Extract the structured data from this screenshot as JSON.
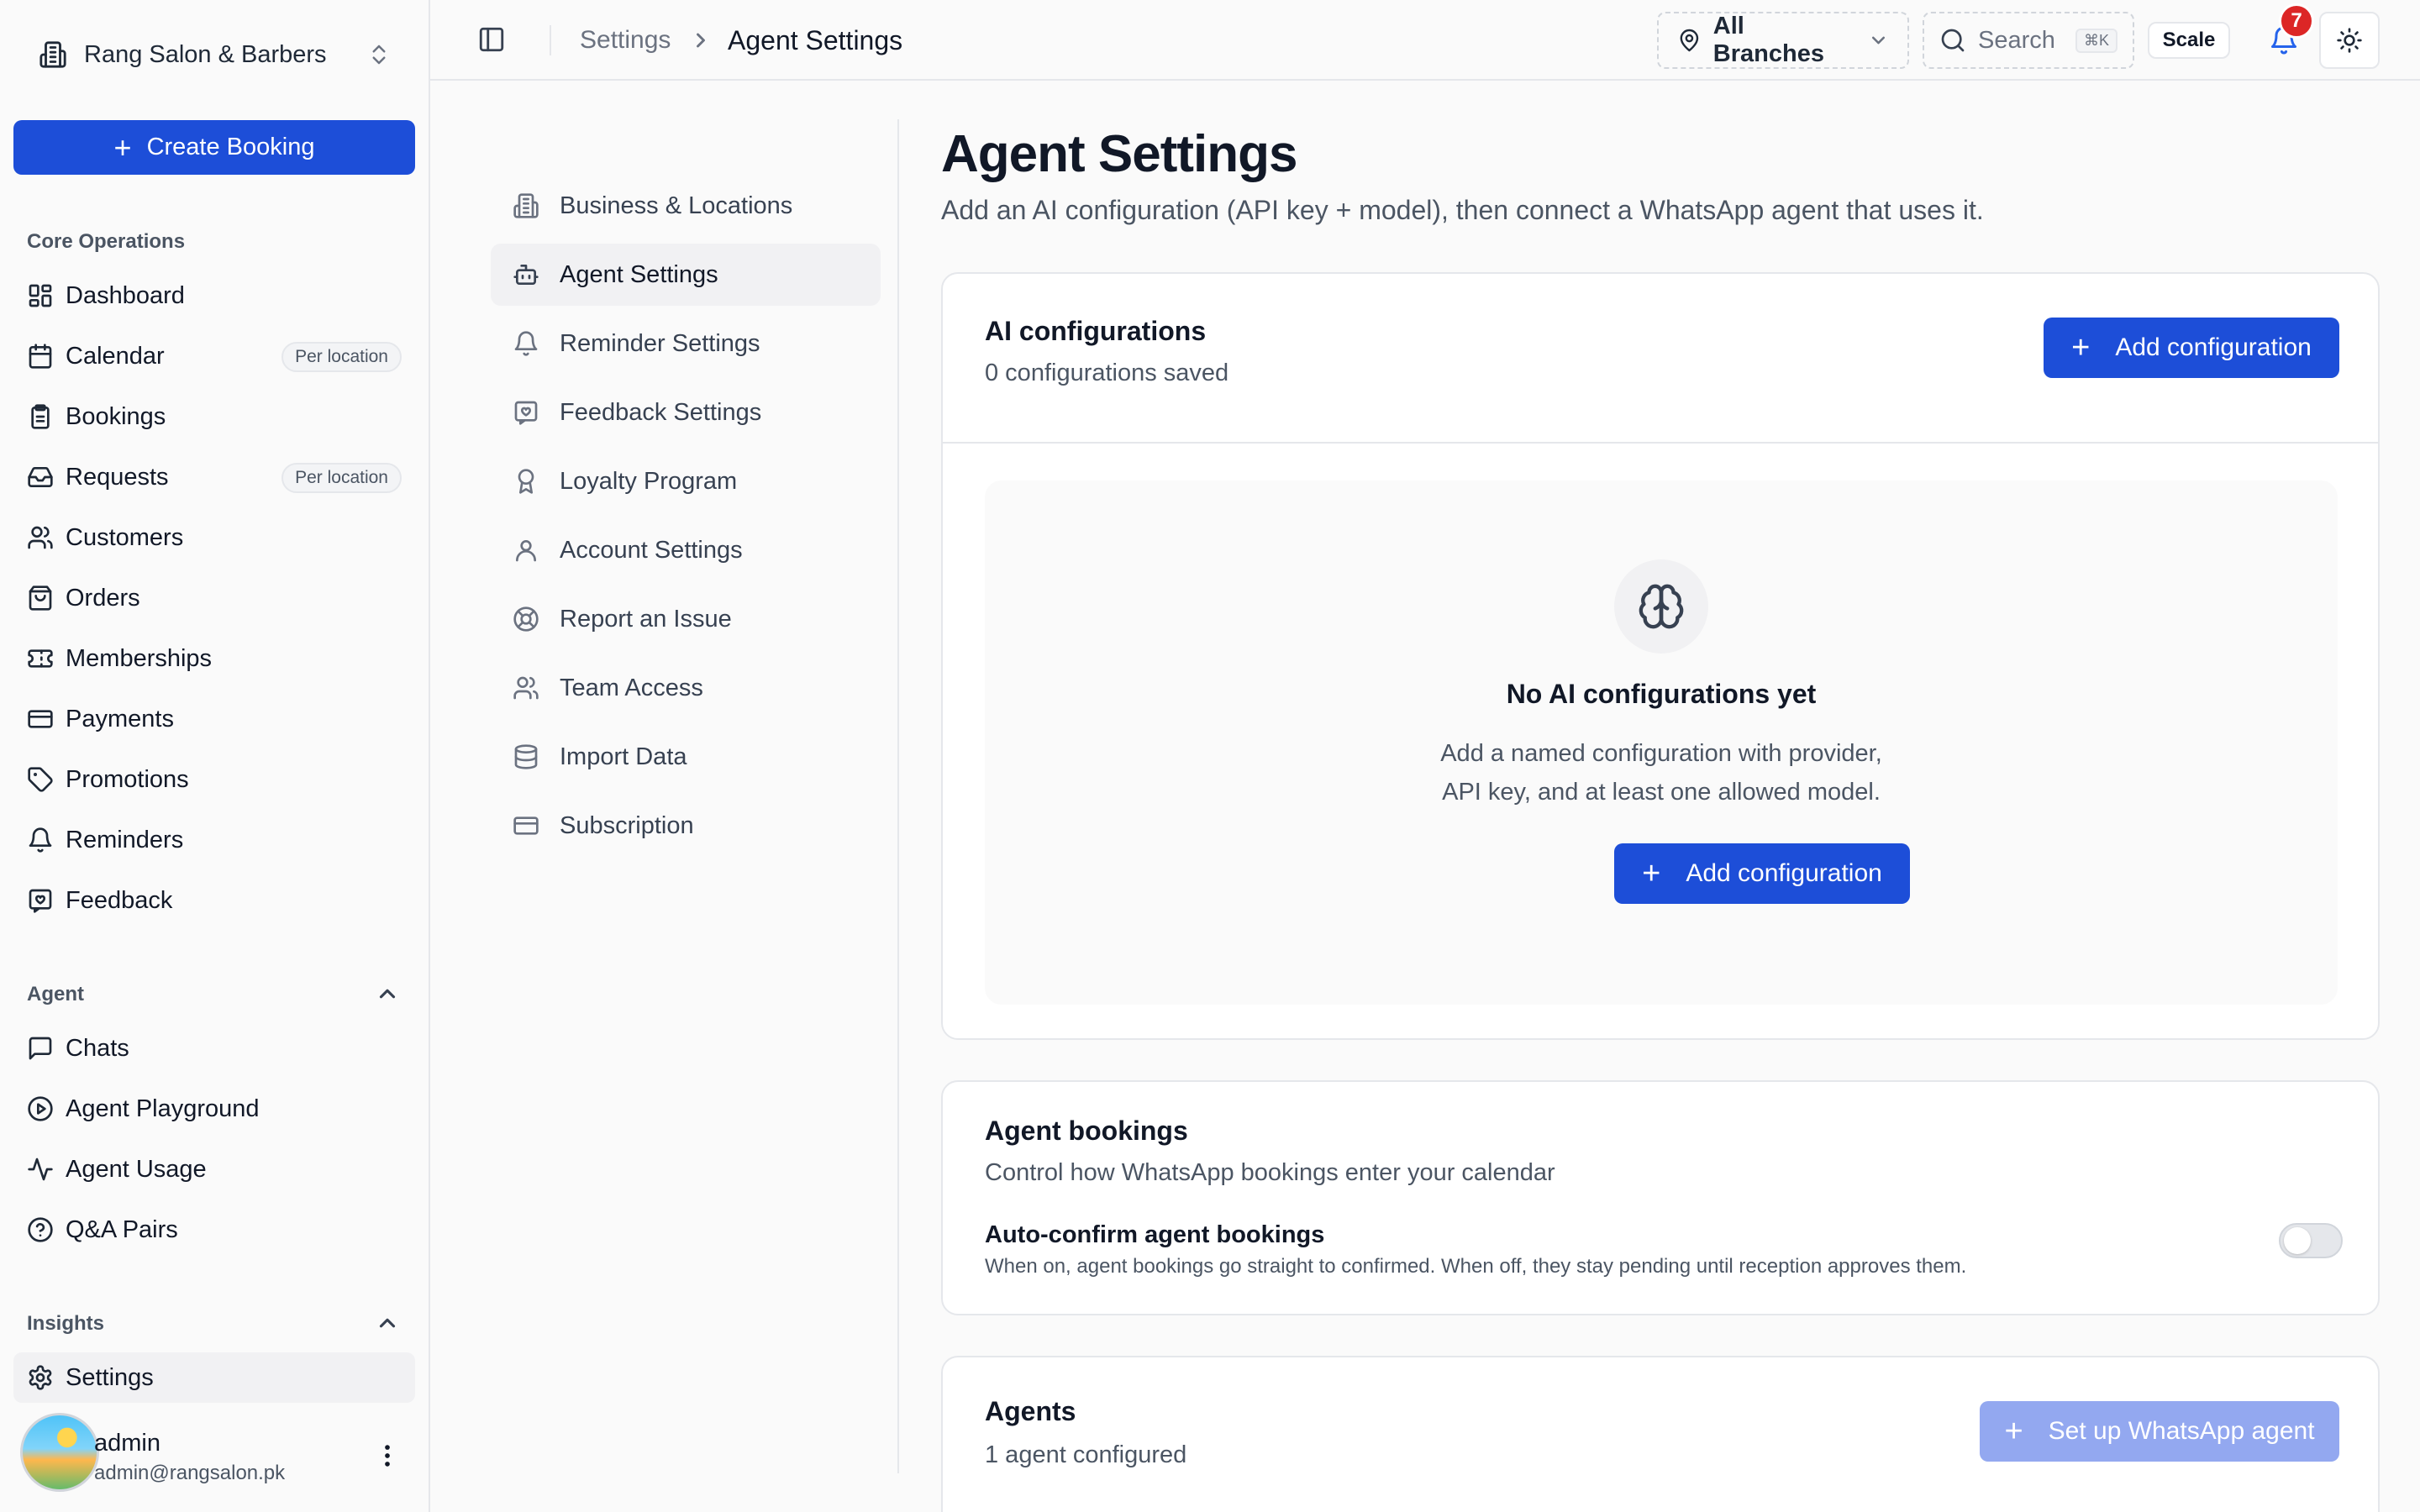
{
  "org": {
    "name": "Rang Salon & Barbers"
  },
  "sidebar": {
    "create_label": "Create Booking",
    "core_label": "Core Operations",
    "core_items": [
      {
        "label": "Dashboard",
        "icon": "dashboard-icon"
      },
      {
        "label": "Calendar",
        "icon": "calendar-icon",
        "badge": "Per location"
      },
      {
        "label": "Bookings",
        "icon": "clipboard-icon"
      },
      {
        "label": "Requests",
        "icon": "inbox-icon",
        "badge": "Per location"
      },
      {
        "label": "Customers",
        "icon": "users-icon"
      },
      {
        "label": "Orders",
        "icon": "shopping-bag-icon"
      },
      {
        "label": "Memberships",
        "icon": "ticket-icon"
      },
      {
        "label": "Payments",
        "icon": "credit-card-icon"
      },
      {
        "label": "Promotions",
        "icon": "tag-icon"
      },
      {
        "label": "Reminders",
        "icon": "bell-icon"
      },
      {
        "label": "Feedback",
        "icon": "message-heart-icon"
      }
    ],
    "agent_label": "Agent",
    "agent_items": [
      {
        "label": "Chats",
        "icon": "chat-icon"
      },
      {
        "label": "Agent Playground",
        "icon": "play-circle-icon"
      },
      {
        "label": "Agent Usage",
        "icon": "activity-icon"
      },
      {
        "label": "Q&A Pairs",
        "icon": "help-circle-icon"
      }
    ],
    "insights_label": "Insights",
    "settings_label": "Settings"
  },
  "user": {
    "name": "admin",
    "email": "admin@rangsalon.pk"
  },
  "topbar": {
    "breadcrumb_parent": "Settings",
    "breadcrumb_current": "Agent Settings",
    "branch": "All Branches",
    "search_placeholder": "Search",
    "search_shortcut": "⌘K",
    "plan": "Scale",
    "notification_count": "7"
  },
  "subnav": [
    {
      "label": "Business & Locations",
      "icon": "building-icon"
    },
    {
      "label": "Agent Settings",
      "icon": "bot-icon",
      "active": true
    },
    {
      "label": "Reminder Settings",
      "icon": "bell-icon"
    },
    {
      "label": "Feedback Settings",
      "icon": "message-heart-icon"
    },
    {
      "label": "Loyalty Program",
      "icon": "award-icon"
    },
    {
      "label": "Account Settings",
      "icon": "user-icon"
    },
    {
      "label": "Report an Issue",
      "icon": "life-buoy-icon"
    },
    {
      "label": "Team Access",
      "icon": "users-icon"
    },
    {
      "label": "Import Data",
      "icon": "database-icon"
    },
    {
      "label": "Subscription",
      "icon": "credit-card-icon"
    }
  ],
  "main": {
    "title": "Agent Settings",
    "subtitle": "Add an AI configuration (API key + model), then connect a WhatsApp agent that uses it.",
    "ai_config": {
      "title": "AI configurations",
      "count": "0 configurations saved",
      "add_label": "Add configuration",
      "empty_title": "No AI configurations yet",
      "empty_line1": "Add a named configuration with provider,",
      "empty_line2": "API key, and at least one allowed model.",
      "empty_add_label": "Add configuration"
    },
    "bookings": {
      "title": "Agent bookings",
      "subtitle": "Control how WhatsApp bookings enter your calendar",
      "option_title": "Auto-confirm agent bookings",
      "option_desc": "When on, agent bookings go straight to confirmed. When off, they stay pending until reception approves them.",
      "auto_confirm": false
    },
    "agents": {
      "title": "Agents",
      "count": "1 agent configured",
      "setup_label": "Set up WhatsApp agent"
    }
  },
  "colors": {
    "accent": "#1d4ed8",
    "badge": "#dc2626"
  }
}
